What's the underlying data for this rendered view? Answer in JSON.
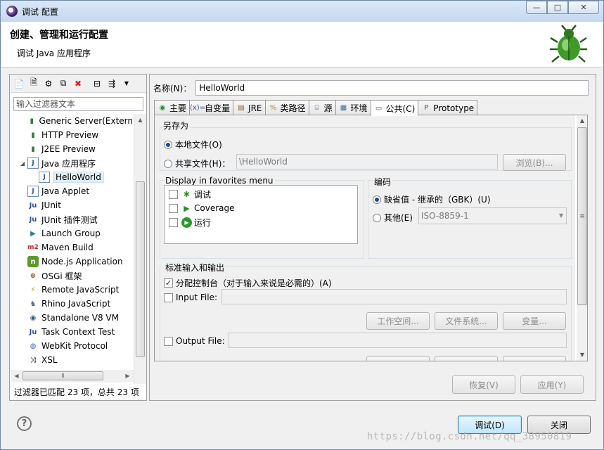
{
  "window": {
    "title": "调试 配置",
    "controls": [
      "—",
      "□",
      "✕"
    ]
  },
  "header": {
    "title": "创建、管理和运行配置",
    "subtitle": "调试 Java 应用程序"
  },
  "left": {
    "filter_placeholder": "输入过滤器文本",
    "tree": [
      {
        "label": "Generic Server(Extern",
        "icon": "generic-server-icon",
        "indent": 1
      },
      {
        "label": "HTTP Preview",
        "icon": "http-preview-icon",
        "indent": 1
      },
      {
        "label": "J2EE Preview",
        "icon": "j2ee-preview-icon",
        "indent": 1
      },
      {
        "label": "Java 应用程序",
        "icon": "java-application-icon",
        "indent": 1,
        "expanded": true
      },
      {
        "label": "HelloWorld",
        "icon": "java-file-icon",
        "indent": 2,
        "selected": true
      },
      {
        "label": "Java Applet",
        "icon": "java-applet-icon",
        "indent": 1
      },
      {
        "label": "JUnit",
        "icon": "junit-icon",
        "indent": 1
      },
      {
        "label": "JUnit 插件测试",
        "icon": "junit-plugin-icon",
        "indent": 1
      },
      {
        "label": "Launch Group",
        "icon": "launch-group-icon",
        "indent": 1
      },
      {
        "label": "Maven Build",
        "icon": "maven-icon",
        "indent": 1
      },
      {
        "label": "Node.js Application",
        "icon": "nodejs-icon",
        "indent": 1
      },
      {
        "label": "OSGi 框架",
        "icon": "osgi-icon",
        "indent": 1
      },
      {
        "label": "Remote JavaScript",
        "icon": "remote-javascript-icon",
        "indent": 1
      },
      {
        "label": "Rhino JavaScript",
        "icon": "rhino-icon",
        "indent": 1
      },
      {
        "label": "Standalone V8 VM",
        "icon": "v8-icon",
        "indent": 1
      },
      {
        "label": "Task Context Test",
        "icon": "task-context-icon",
        "indent": 1
      },
      {
        "label": "WebKit Protocol",
        "icon": "webkit-icon",
        "indent": 1
      },
      {
        "label": "XSL",
        "icon": "xsl-icon",
        "indent": 1
      }
    ],
    "status": "过滤器已匹配 23 项，总共 23 项"
  },
  "right": {
    "name_label": "名称(N)：",
    "name_value": "HelloWorld",
    "tabs": [
      {
        "label": "主要",
        "icon": "main-tab-icon"
      },
      {
        "label": "自变量",
        "icon": "arguments-tab-icon"
      },
      {
        "label": "JRE",
        "icon": "jre-tab-icon"
      },
      {
        "label": "类路径",
        "icon": "classpath-tab-icon"
      },
      {
        "label": "源",
        "icon": "source-tab-icon"
      },
      {
        "label": "环境",
        "icon": "environment-tab-icon"
      },
      {
        "label": "公共(C)",
        "icon": "common-tab-icon",
        "active": true
      },
      {
        "label": "Prototype",
        "icon": "prototype-tab-icon"
      }
    ],
    "save_as": {
      "label": "另存为",
      "local_file": "本地文件(O)",
      "shared_file": "共享文件(H)：",
      "shared_path": "\\HelloWorld",
      "browse": "浏览(B)..."
    },
    "favorites": {
      "label": "Display in favorites menu",
      "items": [
        {
          "label": "调试",
          "checked": false,
          "icon": "debug-icon"
        },
        {
          "label": "Coverage",
          "checked": false,
          "icon": "coverage-icon"
        },
        {
          "label": "运行",
          "checked": false,
          "icon": "run-icon"
        }
      ]
    },
    "encoding": {
      "label": "编码",
      "default_option": "缺省值 - 继承的（GBK）(U)",
      "other_option": "其他(E)",
      "other_value": "ISO-8859-1"
    },
    "stdio": {
      "label": "标准输入和输出",
      "allocate_console": "分配控制台（对于输入来说是必需的）(A)",
      "allocate_checked": true,
      "input_file": "Input File:",
      "output_file": "Output File:",
      "workspace_btn": "工作空间...",
      "filesystem_btn": "文件系统...",
      "variables_btn": "变量..."
    },
    "revert": "恢复(V)",
    "apply": "应用(Y)"
  },
  "footer": {
    "debug": "调试(D)",
    "close": "关闭"
  },
  "watermark": "https://blog.csdn.net/qq_38950819"
}
